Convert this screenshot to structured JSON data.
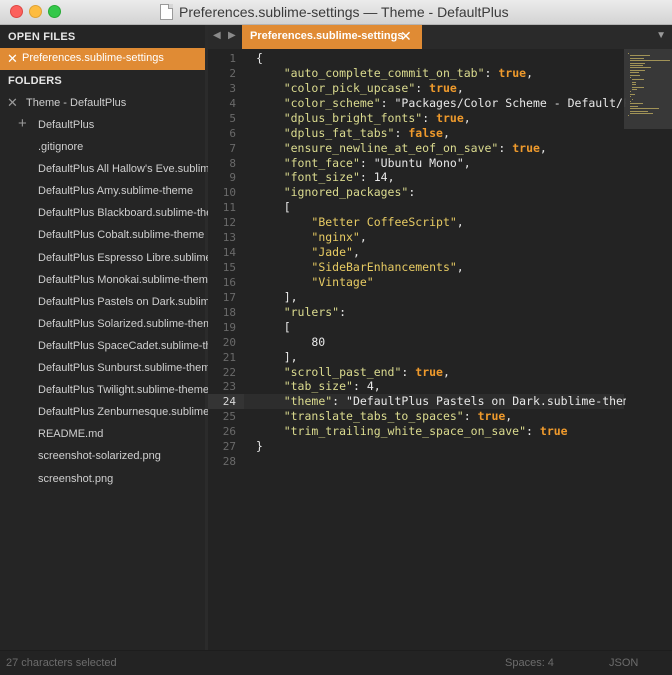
{
  "window": {
    "title": "Preferences.sublime-settings — Theme - DefaultPlus"
  },
  "sidebar": {
    "open_files_heading": "OPEN FILES",
    "open_files": [
      "Preferences.sublime-settings"
    ],
    "folders_heading": "FOLDERS",
    "root_folder": "Theme - DefaultPlus",
    "subfolder": "DefaultPlus",
    "files": [
      ".gitignore",
      "DefaultPlus All Hallow's Eve.sublime-theme",
      "DefaultPlus Amy.sublime-theme",
      "DefaultPlus Blackboard.sublime-theme",
      "DefaultPlus Cobalt.sublime-theme",
      "DefaultPlus Espresso Libre.sublime-theme",
      "DefaultPlus Monokai.sublime-theme",
      "DefaultPlus Pastels on Dark.sublime-theme",
      "DefaultPlus Solarized.sublime-theme",
      "DefaultPlus SpaceCadet.sublime-theme",
      "DefaultPlus Sunburst.sublime-theme",
      "DefaultPlus Twilight.sublime-theme",
      "DefaultPlus Zenburnesque.sublime-theme",
      "README.md",
      "screenshot-solarized.png",
      "screenshot.png"
    ]
  },
  "tabs": [
    {
      "label": "Preferences.sublime-settings",
      "active": true
    }
  ],
  "editor": {
    "current_line": 24,
    "selected_text": "DefaultPlus Pastels on Dark",
    "lines": [
      "{",
      "    \"auto_complete_commit_on_tab\": true,",
      "    \"color_pick_upcase\": true,",
      "    \"color_scheme\": \"Packages/Color Scheme - Default/Pastels on Dark.tmTheme\",",
      "    \"dplus_bright_fonts\": true,",
      "    \"dplus_fat_tabs\": false,",
      "    \"ensure_newline_at_eof_on_save\": true,",
      "    \"font_face\": \"Ubuntu Mono\",",
      "    \"font_size\": 14,",
      "    \"ignored_packages\":",
      "    [",
      "        \"Better CoffeeScript\",",
      "        \"nginx\",",
      "        \"Jade\",",
      "        \"SideBarEnhancements\",",
      "        \"Vintage\"",
      "    ],",
      "    \"rulers\":",
      "    [",
      "        80",
      "    ],",
      "    \"scroll_past_end\": true,",
      "    \"tab_size\": 4,",
      "    \"theme\": \"DefaultPlus Pastels on Dark.sublime-theme\",",
      "    \"translate_tabs_to_spaces\": true,",
      "    \"trim_trailing_white_space_on_save\": true",
      "}",
      ""
    ]
  },
  "statusbar": {
    "selection": "27 characters selected",
    "indentation": "Spaces: 4",
    "syntax": "JSON"
  },
  "colors": {
    "accent": "#e08b34",
    "key": "#dbdb8f",
    "string": "#e7cb63",
    "keyword": "#ef9a2c",
    "selection": "#4b3a51"
  }
}
